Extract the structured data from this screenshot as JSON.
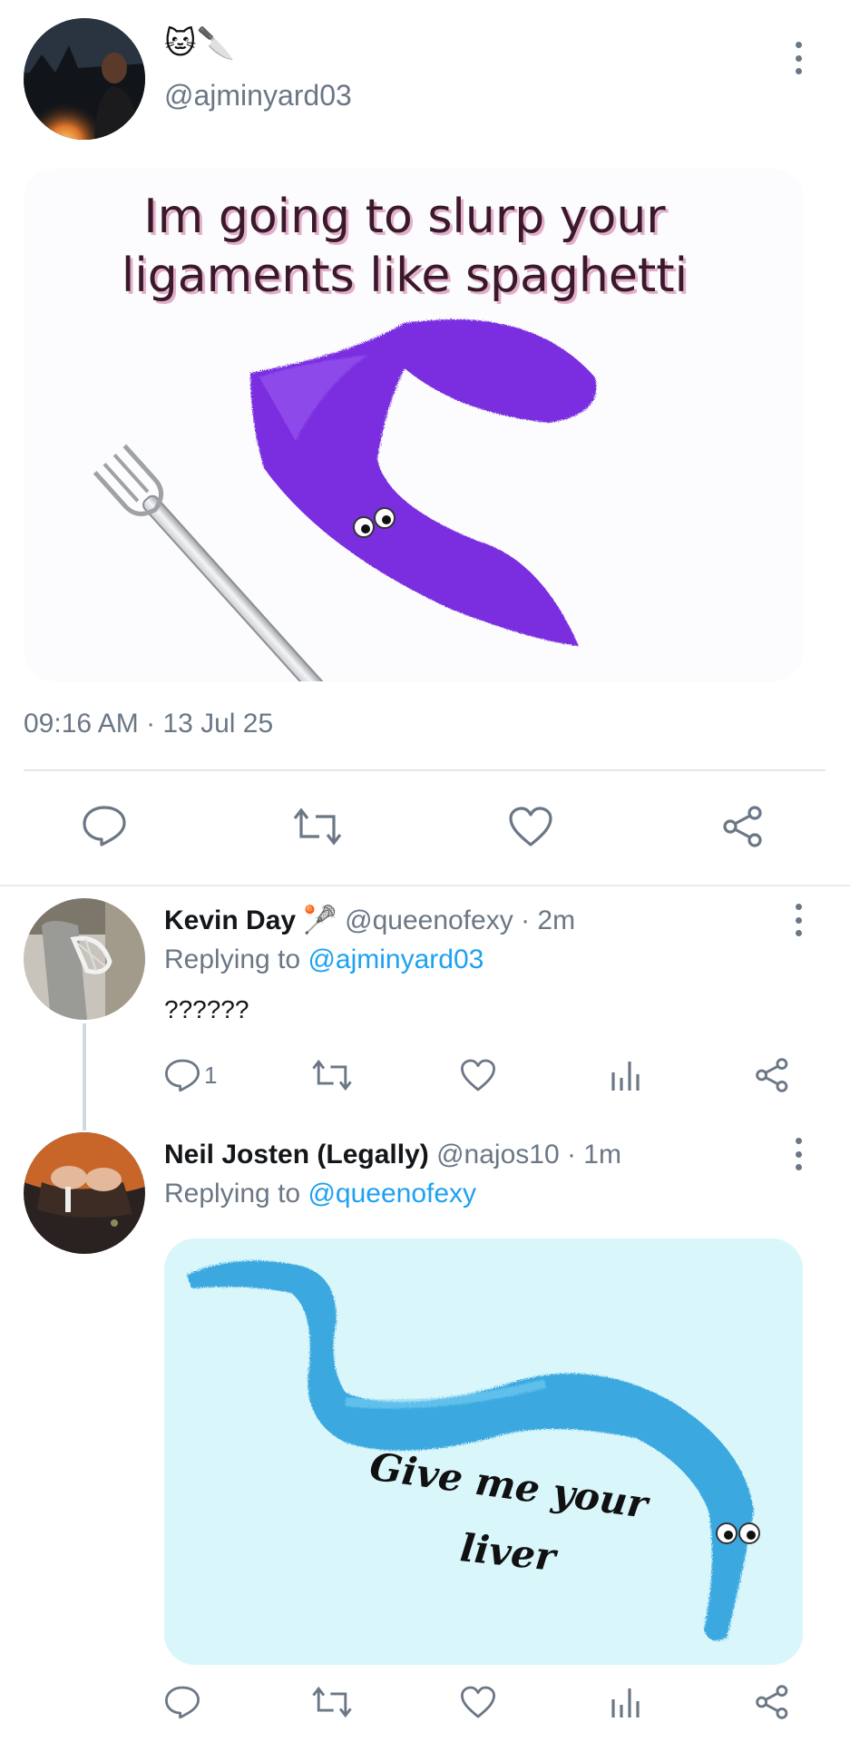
{
  "main_tweet": {
    "display_name_emoji": "🐱🔪",
    "handle": "@ajminyard03",
    "timestamp": "09:16 AM · 13 Jul 25",
    "meme": {
      "caption_line1": "Im going to slurp your",
      "caption_line2": "ligaments like spaghetti"
    },
    "icons": [
      "reply-icon",
      "retweet-icon",
      "heart-icon",
      "share-icon",
      "more-vertical-icon"
    ]
  },
  "replies": [
    {
      "name": "Kevin Day",
      "name_emoji": "🥍",
      "handle": "@queenofexy",
      "time": "· 2m",
      "replying_to_label": "Replying to",
      "replying_to_handle": "@ajminyard03",
      "text": "??????",
      "reply_count": "1"
    },
    {
      "name": "Neil Josten (Legally)",
      "handle": "@najos10",
      "time": "· 1m",
      "replying_to_label": "Replying to",
      "replying_to_handle": "@queenofexy",
      "meme": {
        "caption_line1": "Give me your",
        "caption_line2": "liver"
      }
    }
  ],
  "colors": {
    "accent": "#1da1f2",
    "icon_grey": "#6b7785",
    "divider": "#e1e8ed",
    "purple_worm": "#7a2fe0",
    "blue_worm": "#3aa8e0",
    "meme_bg": "#d9f6fb"
  }
}
